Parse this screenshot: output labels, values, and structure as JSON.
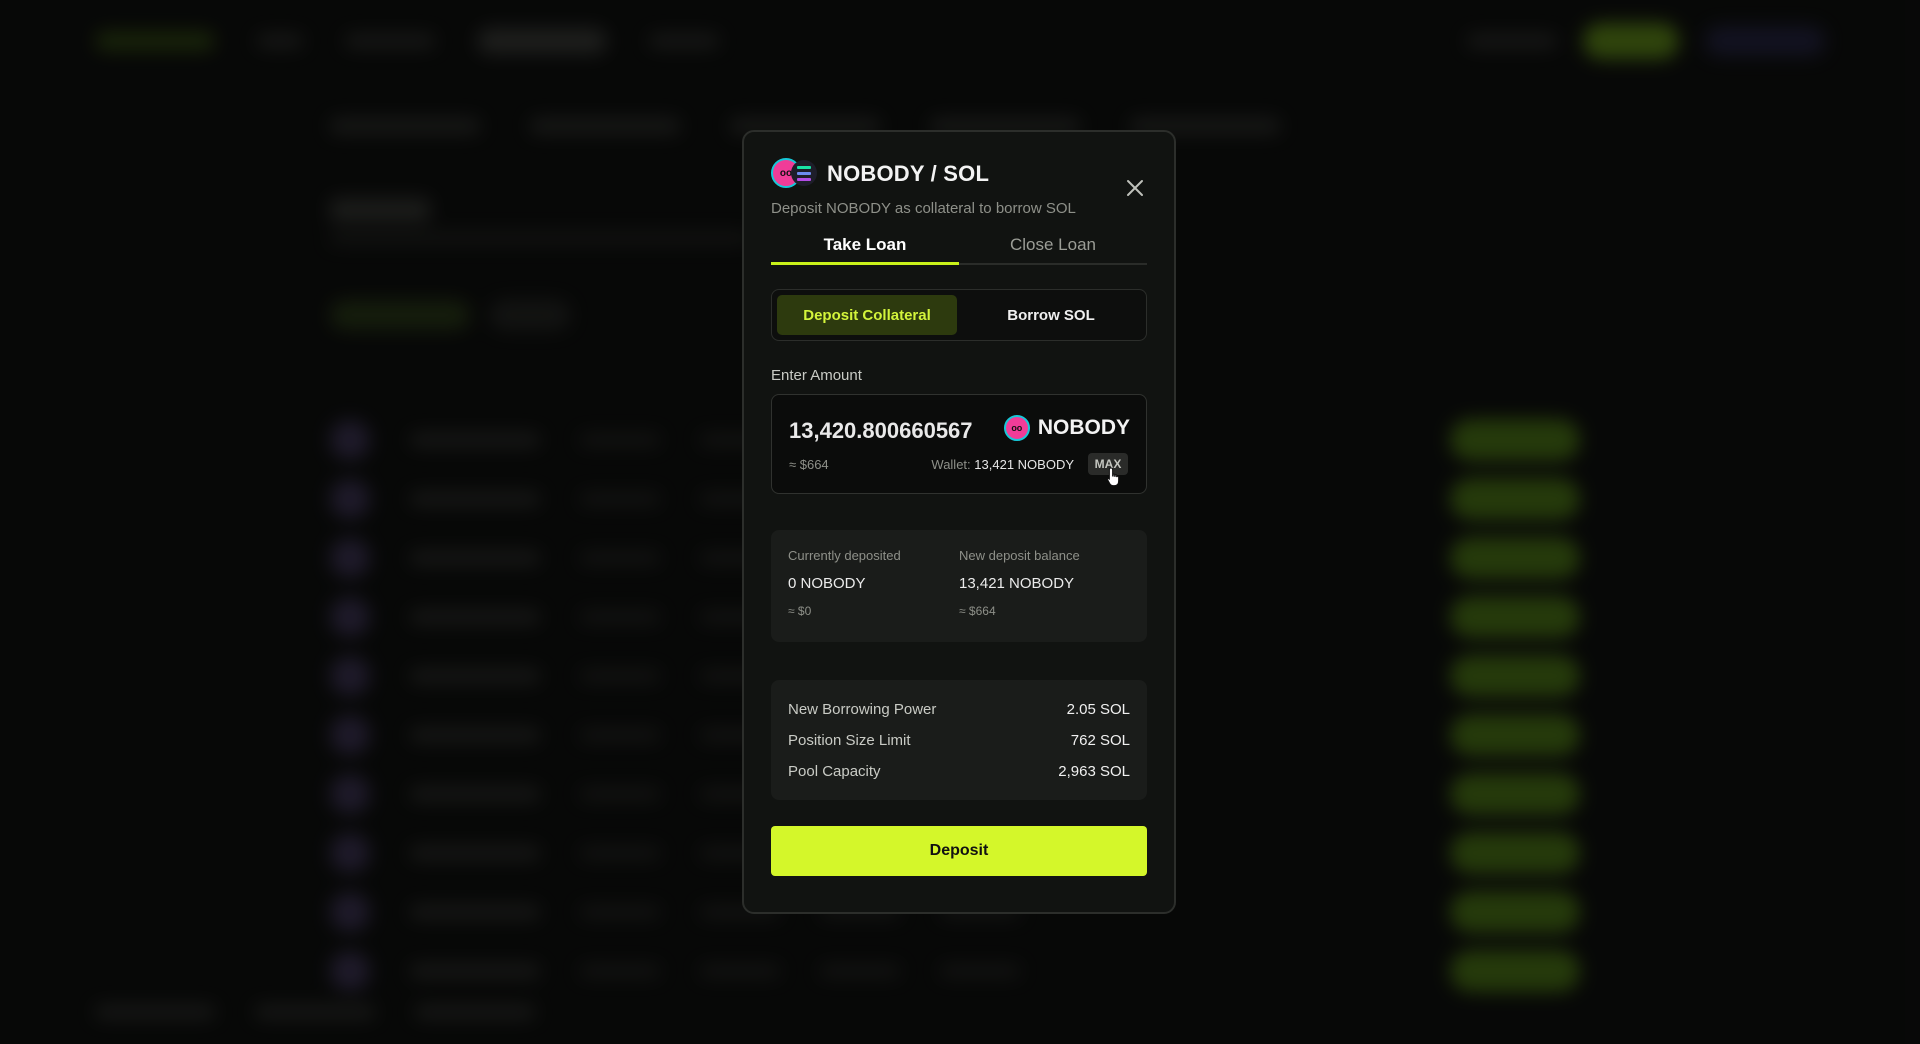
{
  "modal": {
    "title": "NOBODY / SOL",
    "subtitle": "Deposit NOBODY as collateral to borrow SOL",
    "close_icon": "close-icon",
    "tabs": [
      {
        "label": "Take Loan",
        "active": true
      },
      {
        "label": "Close Loan",
        "active": false
      }
    ],
    "segments": [
      {
        "label": "Deposit Collateral",
        "active": true
      },
      {
        "label": "Borrow SOL",
        "active": false
      }
    ],
    "amount": {
      "label": "Enter Amount",
      "value": "13,420.800660567",
      "token": "NOBODY",
      "usd": "≈ $664",
      "wallet_label": "Wallet:",
      "wallet_value": "13,421 NOBODY",
      "max_label": "MAX"
    },
    "deposit_summary": {
      "current_label": "Currently deposited",
      "current_value": "0 NOBODY",
      "current_usd": "≈ $0",
      "new_label": "New deposit balance",
      "new_value": "13,421 NOBODY",
      "new_usd": "≈ $664"
    },
    "stats": [
      {
        "label": "New Borrowing Power",
        "value": "2.05 SOL"
      },
      {
        "label": "Position Size Limit",
        "value": "762 SOL"
      },
      {
        "label": "Pool Capacity",
        "value": "2,963 SOL"
      }
    ],
    "submit_label": "Deposit"
  },
  "colors": {
    "accent": "#d4f72a",
    "background": "#0c0d0c",
    "modal_bg": "#111311",
    "token_pink": "#f03c98"
  }
}
